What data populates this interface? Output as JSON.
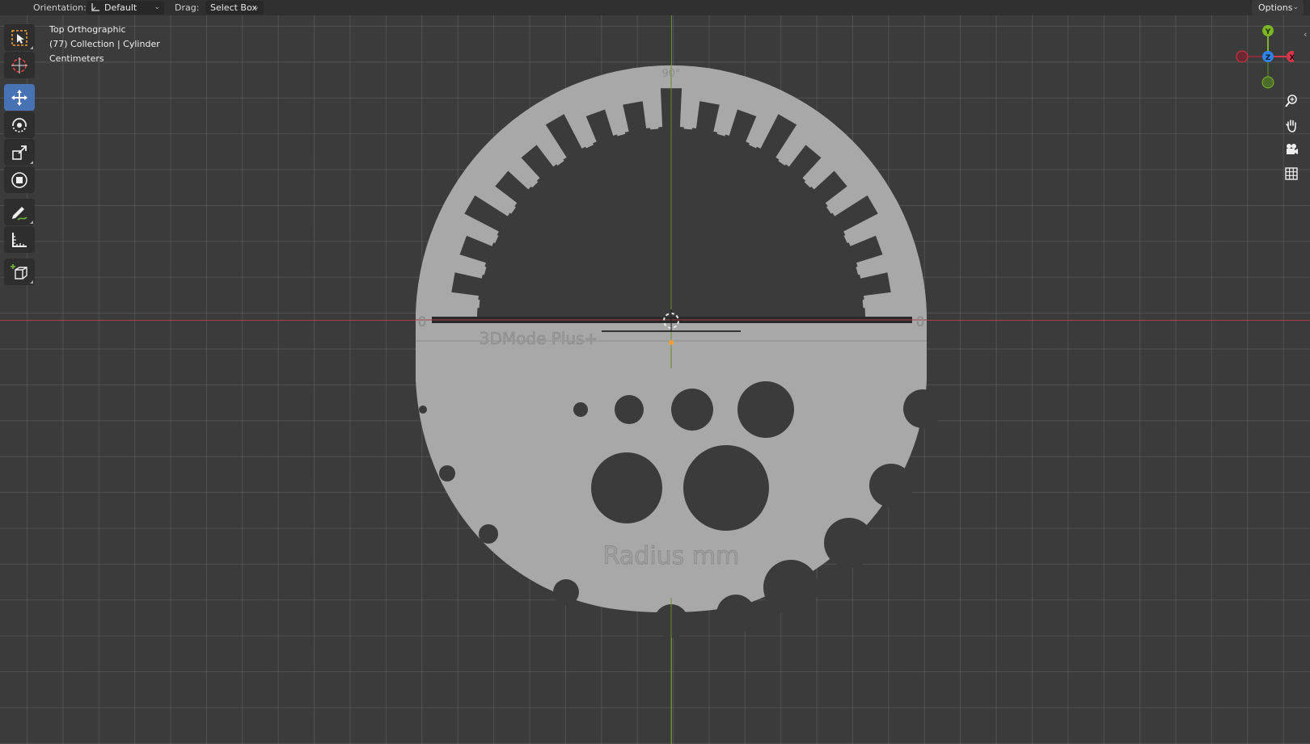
{
  "header": {
    "orientation_label": "Orientation:",
    "orientation_value": "Default",
    "drag_label": "Drag:",
    "drag_value": "Select Box",
    "options_label": "Options"
  },
  "viewport_info": {
    "view_name": "Top Orthographic",
    "collection": "(77) Collection | Cylinder",
    "units": "Centimeters"
  },
  "toolbar": {
    "tools": [
      {
        "name": "select-box-tool",
        "icon": "select-box-icon",
        "active": false
      },
      {
        "name": "cursor-tool",
        "icon": "cursor-icon",
        "active": false
      },
      {
        "name": "move-tool",
        "icon": "move-icon",
        "active": true
      },
      {
        "name": "rotate-tool",
        "icon": "rotate-icon",
        "active": false
      },
      {
        "name": "scale-tool",
        "icon": "scale-icon",
        "active": false
      },
      {
        "name": "transform-tool",
        "icon": "transform-icon",
        "active": false
      },
      {
        "name": "annotate-tool",
        "icon": "annotate-icon",
        "active": false
      },
      {
        "name": "measure-tool",
        "icon": "measure-icon",
        "active": false
      },
      {
        "name": "add-cube-tool",
        "icon": "add-cube-icon",
        "active": false
      }
    ]
  },
  "gizmo": {
    "y": "Y",
    "z": "Z",
    "x": "X"
  },
  "model": {
    "top_angle": "90°",
    "left_zero": "0",
    "right_zero": "0",
    "brand": "3DMode Plus+",
    "radius_label": "Radius mm"
  },
  "colors": {
    "background": "#3b3b3b",
    "model_fill": "#a8a8a8",
    "x_axis": "#a7414b",
    "y_axis": "#6a8e33",
    "active_tool": "#4772b3",
    "gizmo_x": "#d8344a",
    "gizmo_y": "#7cb625",
    "gizmo_z": "#2f83e6"
  },
  "right_buttons": [
    "zoom-icon",
    "hand-pan-icon",
    "camera-icon",
    "grid-icon"
  ]
}
